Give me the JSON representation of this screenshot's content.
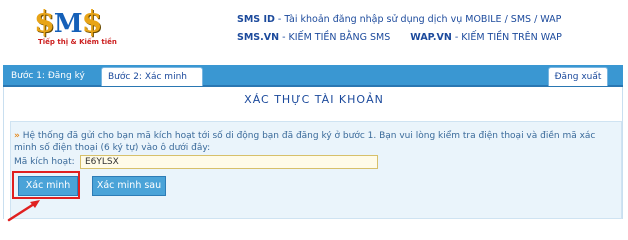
{
  "header": {
    "logo_main": "$M$",
    "logo_tagline": "Tiếp thị & Kiếm tiền",
    "line1_strong": "SMS ID",
    "line1_text": " - Tài khoản đăng nhập sử dụng dịch vụ MOBILE / SMS / WAP",
    "line2a_strong": "SMS.VN",
    "line2a_text": " - KIẾM TIỀN BẰNG SMS",
    "line2b_strong": "WAP.VN",
    "line2b_text": " - KIẾM TIỀN TRÊN WAP"
  },
  "tabs": {
    "step1": "Bước 1: Đăng ký",
    "step2": "Bước 2: Xác minh",
    "logout": "Đăng xuất"
  },
  "main": {
    "title": "XÁC THỰC TÀI KHOẢN",
    "message": "Hệ thống đã gửi cho bạn mã kích hoạt tới số di động bạn đã đăng ký ở bước 1. Bạn vui lòng kiểm tra điện thoại và điền mã xác minh số điện thoại (6 ký tự) vào ô dưới đây:",
    "code_label": "Mã kích hoạt:",
    "code_value": "E6YLSX",
    "verify_button": "Xác minh",
    "verify_later_button": "Xác minh sau"
  },
  "colors": {
    "accent": "#3a97d2",
    "highlight": "#e02020"
  }
}
